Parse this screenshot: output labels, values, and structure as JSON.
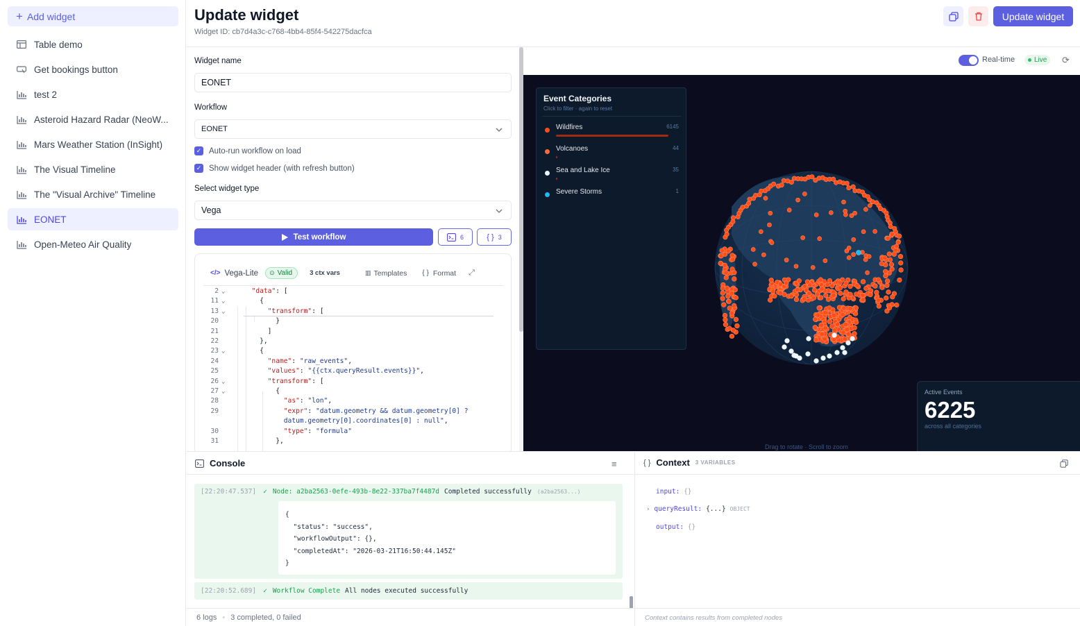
{
  "sidebar": {
    "add_label": "Add widget",
    "items": [
      {
        "label": "Table demo",
        "icon": "table-icon",
        "active": false
      },
      {
        "label": "Get bookings button",
        "icon": "button-icon",
        "active": false
      },
      {
        "label": "test 2",
        "icon": "chart-icon",
        "active": false
      },
      {
        "label": "Asteroid Hazard Radar (NeoW...",
        "icon": "chart-icon",
        "active": false
      },
      {
        "label": "Mars Weather Station (InSight)",
        "icon": "chart-icon",
        "active": false
      },
      {
        "label": "The Visual Timeline",
        "icon": "chart-icon",
        "active": false
      },
      {
        "label": "The \"Visual Archive\" Timeline",
        "icon": "chart-icon",
        "active": false
      },
      {
        "label": "EONET",
        "icon": "chart-icon",
        "active": true
      },
      {
        "label": "Open-Meteo Air Quality",
        "icon": "chart-icon",
        "active": false
      }
    ]
  },
  "header": {
    "title": "Update widget",
    "widget_id": "Widget ID: cb7d4a3c-c768-4bb4-85f4-542275dacfca",
    "update_label": "Update widget"
  },
  "form": {
    "name_label": "Widget name",
    "name_value": "EONET",
    "workflow_label": "Workflow",
    "workflow_value": "EONET",
    "autorun_label": "Auto-run workflow on load",
    "header_label": "Show widget header (with refresh button)",
    "type_label": "Select widget type",
    "type_value": "Vega",
    "test_label": "Test workflow",
    "console_count": "6",
    "ctx_count": "3"
  },
  "editor": {
    "lang": "Vega-Lite",
    "valid": "Valid",
    "ctx_vars": "3 ctx vars",
    "templates": "Templates",
    "format": "Format",
    "lines": [
      {
        "n": "2",
        "fold": true,
        "html": "  <span class='k'>\"data\"</span>: ["
      },
      {
        "n": "11",
        "fold": true,
        "html": "    {"
      },
      {
        "n": "13",
        "fold": true,
        "html": "      <span class='k'>\"transform\"</span>: ["
      },
      {
        "n": "20",
        "fold": false,
        "html": "        }"
      },
      {
        "n": "21",
        "fold": false,
        "html": "      ]"
      },
      {
        "n": "22",
        "fold": false,
        "html": "    },"
      },
      {
        "n": "23",
        "fold": true,
        "html": "    {"
      },
      {
        "n": "24",
        "fold": false,
        "html": "      <span class='k'>\"name\"</span>: <span class='s'>\"raw_events\"</span>,"
      },
      {
        "n": "25",
        "fold": false,
        "html": "      <span class='k'>\"values\"</span>: <span class='s'>\"{{ctx.queryResult.events}}\"</span>,"
      },
      {
        "n": "26",
        "fold": true,
        "html": "      <span class='k'>\"transform\"</span>: ["
      },
      {
        "n": "27",
        "fold": true,
        "html": "        {"
      },
      {
        "n": "28",
        "fold": false,
        "html": "          <span class='k'>\"as\"</span>: <span class='s'>\"lon\"</span>,"
      },
      {
        "n": "29",
        "fold": false,
        "html": "          <span class='k'>\"expr\"</span>: <span class='s'>\"datum.geometry &amp;&amp; datum.geometry[0] ?</span>"
      },
      {
        "n": "",
        "fold": false,
        "html": "          <span class='s'>datum.geometry[0].coordinates[0] : null\"</span>,"
      },
      {
        "n": "30",
        "fold": false,
        "html": "          <span class='k'>\"type\"</span>: <span class='s'>\"formula\"</span>"
      },
      {
        "n": "31",
        "fold": false,
        "html": "        },"
      }
    ]
  },
  "viz": {
    "realtime_label": "Real-time",
    "live_label": "Live",
    "legend_title": "Event Categories",
    "legend_hint": "Click to filter · again to reset",
    "categories": [
      {
        "name": "Wildfires",
        "count": "6145",
        "color": "#ff4d1a"
      },
      {
        "name": "Volcanoes",
        "count": "44",
        "color": "#ff6a3a"
      },
      {
        "name": "Sea and Lake Ice",
        "count": "35",
        "color": "#e8f7ff"
      },
      {
        "name": "Severe Storms",
        "count": "1",
        "color": "#22b8f0"
      }
    ],
    "active_title": "Active Events",
    "active_value": "6225",
    "active_sub": "across all categories",
    "drag_hint": "Drag to rotate · Scroll to zoom"
  },
  "console": {
    "title": "Console",
    "log1_time": "[22:20:47.537]",
    "log1_node": "Node: a2ba2563-0efe-493b-8e22-337ba7f4487d",
    "log1_msg": "Completed successfully",
    "log1_tag": "(a2ba2563...)",
    "json_lines": [
      "{",
      "  \"status\": \"success\",",
      "  \"workflowOutput\": {},",
      "  \"completedAt\": \"2026-03-21T16:50:44.145Z\"",
      "}"
    ],
    "log2_time": "[22:20:52.689]",
    "log2_title": "Workflow Complete",
    "log2_msg": "All nodes executed successfully",
    "footer_logs": "6 logs",
    "footer_status": "3 completed, 0 failed"
  },
  "context": {
    "title": "Context",
    "badge": "3 VARIABLES",
    "input_key": "input:",
    "input_val": "{}",
    "query_key": "queryResult:",
    "query_val": "{...}",
    "query_type": "OBJECT",
    "output_key": "output:",
    "output_val": "{}",
    "footer": "Context contains results from completed nodes"
  }
}
